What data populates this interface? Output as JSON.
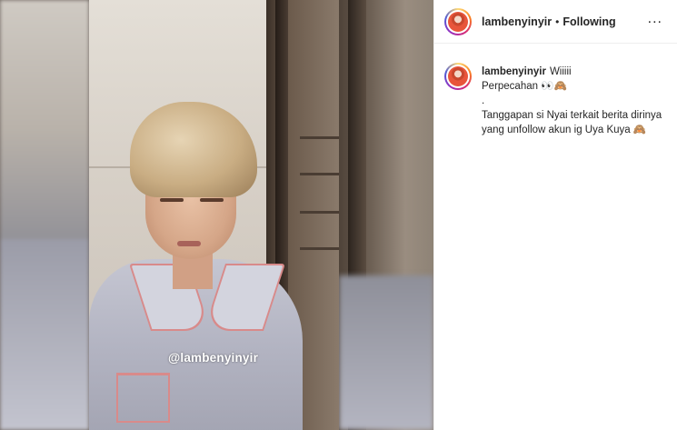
{
  "post": {
    "username": "lambenyinyir",
    "follow_status": "Following",
    "separator": "•",
    "more_icon": "..."
  },
  "media": {
    "watermark": "@lambenyinyir"
  },
  "caption": {
    "username": "lambenyinyir",
    "line1": "Wiiiii",
    "line2": "Perpecahan 👀🙈",
    "line3": ".",
    "line4": "Tanggapan si Nyai terkait berita dirinya yang unfollow akun ig Uya Kuya 🙈"
  }
}
